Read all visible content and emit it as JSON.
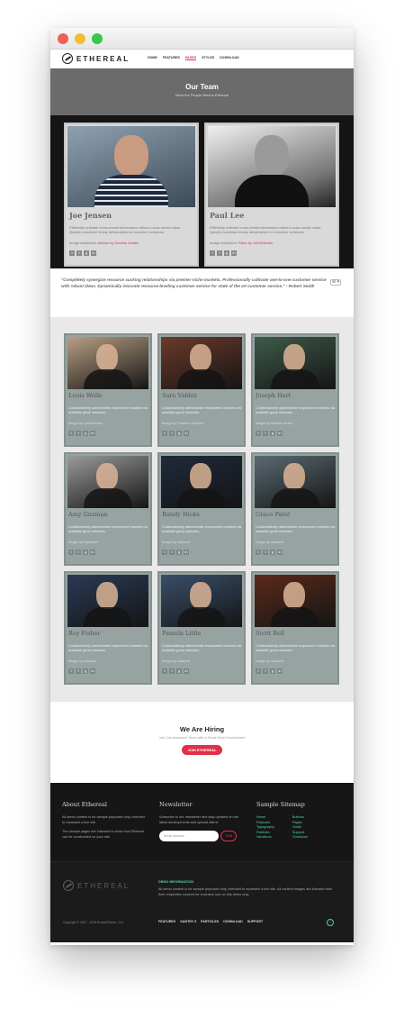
{
  "site": {
    "logo_text": "ETHEREAL"
  },
  "nav": {
    "items": [
      "HOME",
      "FEATURES",
      "PAGES",
      "STYLES",
      "DOWNLOAD"
    ],
    "active": "PAGES"
  },
  "hero": {
    "title": "Our Team",
    "subtitle": "Meet the People Behind Ethereal"
  },
  "featured": [
    {
      "name": "Joe Jensen",
      "desc": "Efficiently unleash cross-media information without cross-media value. Quickly maximize timely deliverables for real-time schemas.",
      "credit_prefix": "Image attribution:",
      "credit_link": "AMoss by Daniele Zedda"
    },
    {
      "name": "Paul Lee",
      "desc": "Efficiently unleash cross-media information without cross-media value. Quickly maximize timely deliverables for real-time schemas.",
      "credit_prefix": "Image attribution:",
      "credit_link": "Store by JohnDNolan"
    }
  ],
  "quote": {
    "text": "\"Completely synergize resource sucking relationships via premier niche markets. Professionally cultivate one-to-one customer service with robust ideas. Dynamically innovate resource-leveling customer service for state of the art customer service.\" - Robert Smith",
    "gear": "⚙ ▾"
  },
  "team": [
    {
      "name": "Louis Wells",
      "credit": "JohnDNolan",
      "color": "#b89e82"
    },
    {
      "name": "Sara Valdez",
      "credit": "Thomas Leuthard",
      "color": "#6b3a2a"
    },
    {
      "name": "Joseph Hart",
      "credit": "Daniele Zedda",
      "color": "#3e5a4a"
    },
    {
      "name": "Amy Guzman",
      "credit": "Abysdrain",
      "color": "#9a9a9a"
    },
    {
      "name": "Randy Hicks",
      "credit": "carawolf",
      "color": "#1f2a3a"
    },
    {
      "name": "Grace Patel",
      "credit": "carawolf",
      "color": "#5a6a72"
    },
    {
      "name": "Roy Fisher",
      "credit": "carawolf",
      "color": "#2a3a55"
    },
    {
      "name": "Pamela Little",
      "credit": "carawolf",
      "color": "#3a4f6a"
    },
    {
      "name": "Scott Bell",
      "credit": "carawolf",
      "color": "#5a2a1a"
    }
  ],
  "team_desc": "Collaboratively administrate empowered markets via available great networks.",
  "team_credit_prefix": "Image by",
  "hiring": {
    "title": "We Are Hiring",
    "subtitle": "Join Our Awesome Team with a Great Work Environment",
    "button": "JOIN ETHEREAL"
  },
  "footer": {
    "about_title": "About Ethereal",
    "about_p1": "All demo content is for sample purposes only, intended to represent a live site.",
    "about_p2": "The sample pages are intended to show how Ethereal can be constructed on your site.",
    "newsletter_title": "Newsletter",
    "newsletter_text": "Subscribe to our newsletter and stay updated on the latest developments and special offers!",
    "email_placeholder": "Email address",
    "join_label": "JOIN",
    "sitemap_title": "Sample Sitemap",
    "sitemap_col1": [
      "Home",
      "Features",
      "Typography",
      "Particles",
      "Variations"
    ],
    "sitemap_col2": [
      "Buttons",
      "Pages",
      "Guide",
      "Support",
      "Download"
    ]
  },
  "copyright": {
    "demo_title": "DEMO INFORMATION",
    "demo_text": "All demo content is for sample purposes only, intended to represent a live site. All content images are licensed from their respective sources for exclusive use on this demo only.",
    "copy": "Copyright © 2007 - 2015 RocketTheme, LLC",
    "nav": [
      "FEATURES",
      "GANTRY 5",
      "PARTICLES",
      "DOWNLOAD",
      "SUPPORT"
    ]
  },
  "colors": {
    "accent": "#e0304a",
    "link_green": "#4fd6a0",
    "card_gray": "#96a3a1"
  }
}
